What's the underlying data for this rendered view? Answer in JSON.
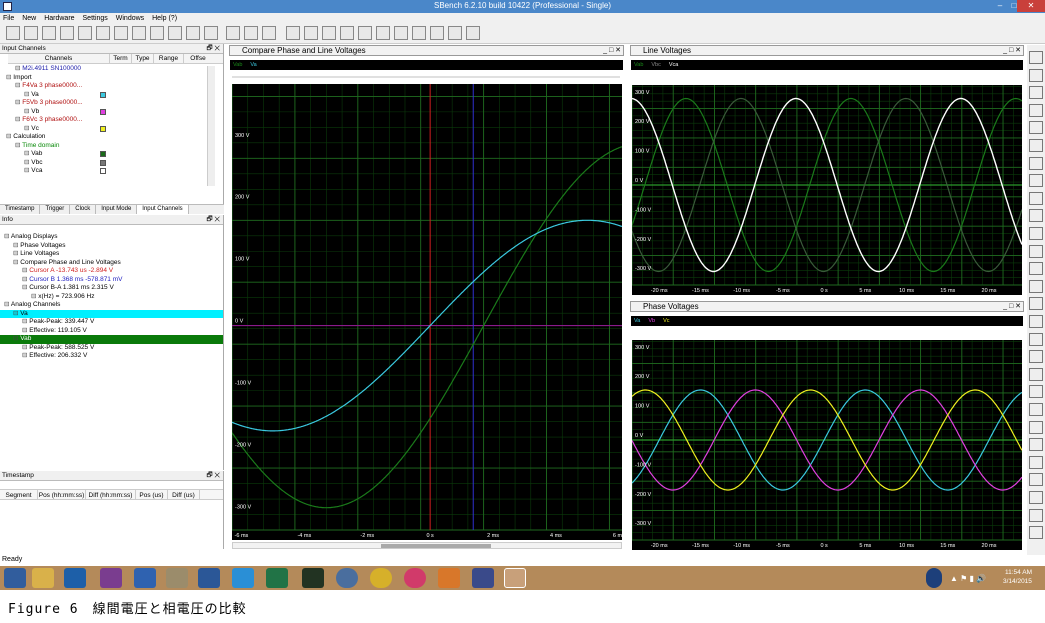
{
  "window": {
    "title": "SBench 6.2.10 build 10422 (Professional - Single)"
  },
  "menu": [
    "File",
    "New",
    "Hardware",
    "Settings",
    "Windows",
    "Help (?)"
  ],
  "input_channels": {
    "title": "Input Channels",
    "columns": [
      "Channels",
      "Term",
      "Type",
      "Range",
      "Offse"
    ],
    "rows": [
      {
        "text": "M2i.4911 SN100000",
        "indent": 1,
        "color": "#1a1aa8"
      },
      {
        "text": "Import",
        "indent": 0,
        "color": "#000"
      },
      {
        "text": "F4Va 3 phase0000...",
        "indent": 1,
        "color": "#b01010"
      },
      {
        "text": "Va",
        "indent": 2,
        "color": "#000",
        "swatch": "#3bc9e0"
      },
      {
        "text": "F5Vb 3 phase0000...",
        "indent": 1,
        "color": "#b01010"
      },
      {
        "text": "Vb",
        "indent": 2,
        "color": "#000",
        "swatch": "#e040e0"
      },
      {
        "text": "F6Vc 3 phase0000...",
        "indent": 1,
        "color": "#b01010"
      },
      {
        "text": "Vc",
        "indent": 2,
        "color": "#000",
        "swatch": "#f0f020"
      },
      {
        "text": "Calculation",
        "indent": 0,
        "color": "#000"
      },
      {
        "text": "Time domain",
        "indent": 1,
        "color": "#0a8a0a"
      },
      {
        "text": "Vab",
        "indent": 2,
        "color": "#000",
        "swatch": "#1a6a1a"
      },
      {
        "text": "Vbc",
        "indent": 2,
        "color": "#000",
        "swatch": "#777777"
      },
      {
        "text": "Vca",
        "indent": 2,
        "color": "#000",
        "swatch": "#ffffff"
      }
    ],
    "tabs": [
      "Timestamp",
      "Trigger",
      "Clock",
      "Input Mode",
      "Input Channels"
    ]
  },
  "info": {
    "title": "Info",
    "rows": [
      {
        "text": "Analog Displays",
        "indent": 0,
        "color": "#000"
      },
      {
        "text": "Phase Voltages",
        "indent": 1,
        "color": "#000"
      },
      {
        "text": "Line Voltages",
        "indent": 1,
        "color": "#000"
      },
      {
        "text": "Compare Phase and Line Voltages",
        "indent": 1,
        "color": "#000"
      },
      {
        "text": "Cursor A  -13.743 us  -2.894 V",
        "indent": 2,
        "color": "#d02020"
      },
      {
        "text": "Cursor B  1.368 ms  -578.871 mV",
        "indent": 2,
        "color": "#2020c0"
      },
      {
        "text": "Cursor B-A  1.381 ms  2.315 V",
        "indent": 2,
        "color": "#000"
      },
      {
        "text": "x(Hz) = 723.906 Hz",
        "indent": 3,
        "color": "#000"
      },
      {
        "text": "Analog Channels",
        "indent": 0,
        "color": "#000"
      },
      {
        "text": "Va",
        "indent": 1,
        "color": "#000",
        "bar": "#00f0ff"
      },
      {
        "text": "Peak-Peak:  339.447 V",
        "indent": 2,
        "color": "#000"
      },
      {
        "text": "Effective:  119.105 V",
        "indent": 2,
        "color": "#000"
      },
      {
        "text": "Vab",
        "indent": 1,
        "color": "#fff",
        "bar": "#0a7a0a"
      },
      {
        "text": "Peak-Peak:  588.525 V",
        "indent": 2,
        "color": "#000"
      },
      {
        "text": "Effective:  206.332 V",
        "indent": 2,
        "color": "#000"
      }
    ]
  },
  "timestamp": {
    "title": "Timestamp",
    "columns": [
      "Segment",
      "Pos (hh:mm:ss)",
      "Diff (hh:mm:ss)",
      "Pos (us)",
      "Diff (us)"
    ]
  },
  "status": "Ready",
  "compare_window": {
    "title": "Compare Phase and Line Voltages",
    "legend": [
      {
        "name": "Vab",
        "color": "#1a8a1a"
      },
      {
        "name": "Va",
        "color": "#3bc9e0"
      }
    ],
    "y_ticks": [
      "300 V",
      "200 V",
      "100 V",
      "0 V",
      "-100 V",
      "-200 V",
      "-300 V"
    ],
    "x_ticks": [
      "-6 ms",
      "-4 ms",
      "-2 ms",
      "0 s",
      "2 ms",
      "4 ms",
      "6 ms"
    ]
  },
  "line_window": {
    "title": "Line Voltages",
    "legend": [
      {
        "name": "Vab",
        "color": "#1a8a1a"
      },
      {
        "name": "Vbc",
        "color": "#888888"
      },
      {
        "name": "Vca",
        "color": "#ffffff"
      }
    ],
    "y_ticks": [
      "300 V",
      "200 V",
      "100 V",
      "0 V",
      "-100 V",
      "-200 V",
      "-300 V"
    ],
    "x_ticks": [
      "-20 ms",
      "-15 ms",
      "-10 ms",
      "-5 ms",
      "0 s",
      "5 ms",
      "10 ms",
      "15 ms",
      "20 ms"
    ]
  },
  "phase_window": {
    "title": "Phase Voltages",
    "legend": [
      {
        "name": "Va",
        "color": "#3bc9e0"
      },
      {
        "name": "Vb",
        "color": "#e040e0"
      },
      {
        "name": "Vc",
        "color": "#f0f020"
      }
    ],
    "y_ticks": [
      "300 V",
      "200 V",
      "100 V",
      "0 V",
      "-100 V",
      "-200 V",
      "-300 V"
    ],
    "x_ticks": [
      "-20 ms",
      "-15 ms",
      "-10 ms",
      "-5 ms",
      "0 s",
      "5 ms",
      "10 ms",
      "15 ms",
      "20 ms"
    ]
  },
  "taskbar": {
    "time": "11:54 AM",
    "date": "3/14/2015"
  },
  "caption": "Figure 6　線間電圧と相電圧の比較"
}
